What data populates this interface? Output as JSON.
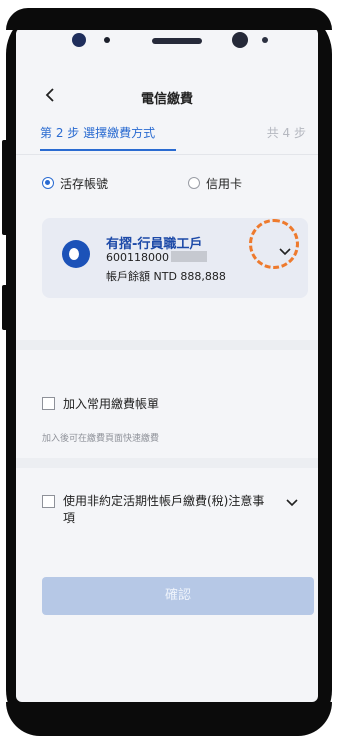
{
  "header": {
    "title": "電信繳費"
  },
  "steps": {
    "current": "第 2 步 選擇繳費方式",
    "total": "共 4 步"
  },
  "account_type": {
    "options": [
      {
        "label": "活存帳號",
        "selected": true
      },
      {
        "label": "信用卡",
        "selected": false
      }
    ]
  },
  "account_card": {
    "name": "有摺-行員職工戶",
    "number": "600118000",
    "balance": "帳戶餘額 NTD 888,888"
  },
  "favorite": {
    "label": "加入常用繳費帳單",
    "hint": "加入後可在繳費頁面快速繳費"
  },
  "notice": {
    "label_line1": "使用非約定活期性帳戶繳費(稅)注意事",
    "label_line2": "項"
  },
  "confirm_label": "確認",
  "colors": {
    "accent": "#2a6bd1",
    "highlight": "#ee7a2d",
    "button_disabled": "#b6c8e6"
  }
}
